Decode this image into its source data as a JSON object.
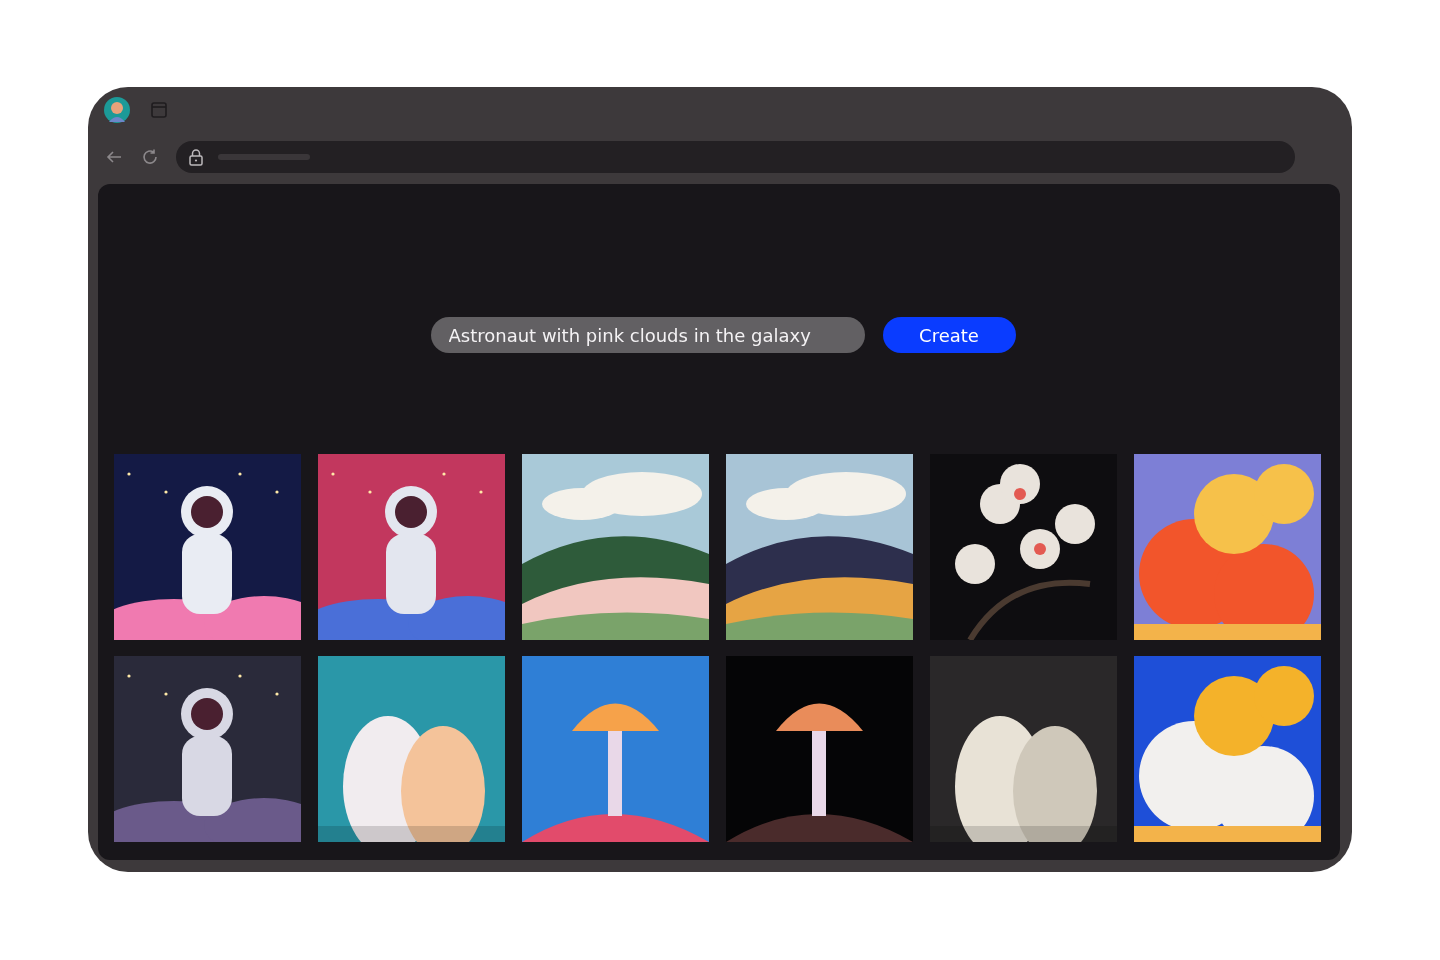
{
  "browser": {
    "kind": "browser"
  },
  "prompt": {
    "value": "Astronaut with pink clouds in the galaxy"
  },
  "create_button": {
    "label": "Create"
  }
}
